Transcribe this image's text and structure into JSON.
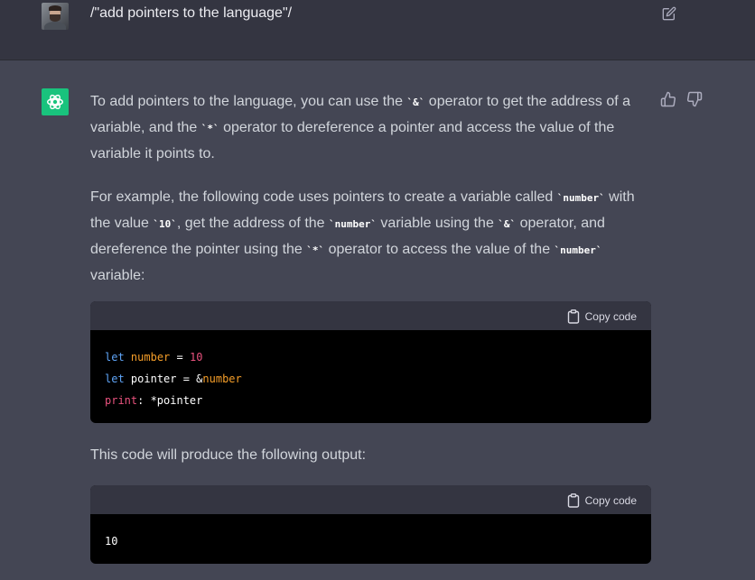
{
  "user_message": {
    "text": "/\"add pointers to the language\"/",
    "avatar_icon": "user-avatar",
    "edit_icon": "edit-icon"
  },
  "assistant": {
    "logo_icon": "openai-logo",
    "paragraph1": {
      "a": "To add pointers to the language, you can use the ",
      "code1": "`&`",
      "b": " operator to get the address of a variable, and the ",
      "code2": "`*`",
      "c": " operator to dereference a pointer and access the value of the variable it points to."
    },
    "paragraph2": {
      "a": "For example, the following code uses pointers to create a variable called ",
      "code1": "`number`",
      "b": " with the value ",
      "code2": "`10`",
      "c": ", get the address of the ",
      "code3": "`number`",
      "d": " variable using the ",
      "code4": "`&`",
      "e": " operator, and dereference the pointer using the ",
      "code5": "`*`",
      "f": " operator to access the value of the ",
      "code6": "`number`",
      "g": " variable:"
    },
    "code_block_1": {
      "copy_label": "Copy code",
      "line1": {
        "kw": "let",
        "name": "number",
        "op": " = ",
        "value": "10"
      },
      "line2": {
        "kw": "let",
        "name": "pointer",
        "op": " = &",
        "ref": "number"
      },
      "line3": {
        "fn": "print",
        "rest": ": *pointer"
      }
    },
    "paragraph3": "This code will produce the following output:",
    "code_block_2": {
      "copy_label": "Copy code",
      "output": "10"
    },
    "feedback": {
      "thumbs_up_icon": "thumbs-up-icon",
      "thumbs_down_icon": "thumbs-down-icon"
    }
  },
  "colors": {
    "user_bg": "#343541",
    "assistant_bg": "#444654",
    "accent": "#19c37d",
    "keyword": "#5ea3f5",
    "variable": "#f59e29",
    "number": "#e9527e"
  }
}
